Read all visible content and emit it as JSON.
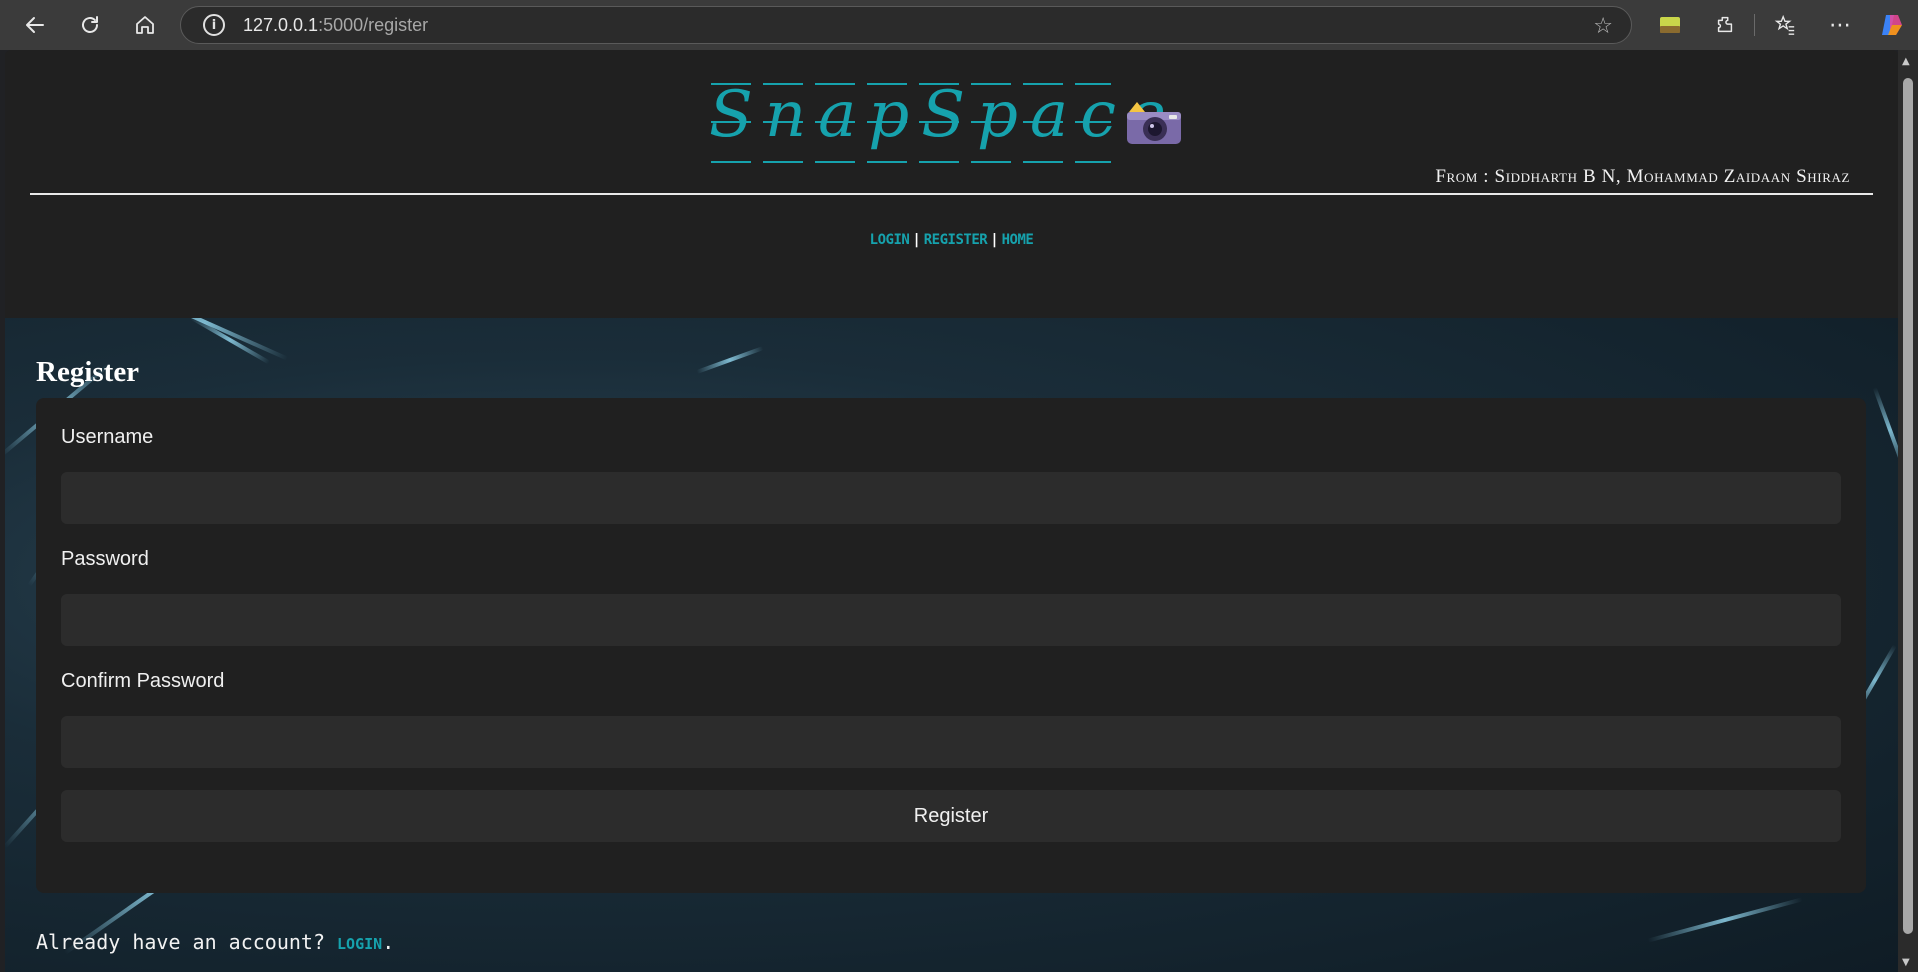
{
  "browser": {
    "url_host": "127.0.0.1",
    "url_path": ":5000/register",
    "icons": [
      "back-icon",
      "reload-icon",
      "home-icon",
      "info-icon",
      "star-icon",
      "extension-icon",
      "puzzle-icon",
      "favorites-icon",
      "more-icon",
      "copilot-icon"
    ]
  },
  "header": {
    "logo_text": "SnapSpace",
    "camera_emoji": "📷",
    "credits": "From : Siddharth B N, Mohammad Zaidaan Shiraz",
    "nav": {
      "login": "LOGIN",
      "sep1": "|",
      "register": "REGISTER",
      "sep2": "|",
      "home": "HOME"
    }
  },
  "form": {
    "title": "Register",
    "username_label": "Username",
    "password_label": "Password",
    "confirm_label": "Confirm Password",
    "username_value": "",
    "password_value": "",
    "confirm_value": "",
    "submit_label": "Register"
  },
  "footer": {
    "prompt": "Already have an account?",
    "login_link": "LOGIN",
    "period": "."
  },
  "colors": {
    "accent": "#16a2ad",
    "background": "#202020",
    "input_bg": "#2c2c2c"
  }
}
